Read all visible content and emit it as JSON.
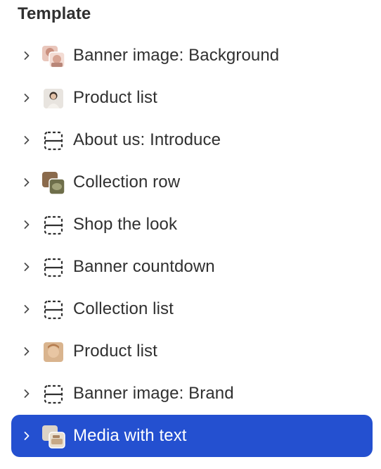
{
  "panel": {
    "title": "Template"
  },
  "sections": [
    {
      "label": "Banner image: Background",
      "icon": "image-thumbnail-icon",
      "thumb": "photo-pink"
    },
    {
      "label": "Product list",
      "icon": "image-thumbnail-icon",
      "thumb": "photo-portrait"
    },
    {
      "label": "About us: Introduce",
      "icon": "section-placeholder-icon",
      "thumb": "placeholder"
    },
    {
      "label": "Collection row",
      "icon": "image-thumbnail-icon",
      "thumb": "photo-green"
    },
    {
      "label": "Shop the look",
      "icon": "section-placeholder-icon",
      "thumb": "placeholder"
    },
    {
      "label": "Banner countdown",
      "icon": "section-placeholder-icon",
      "thumb": "placeholder"
    },
    {
      "label": "Collection list",
      "icon": "section-placeholder-icon",
      "thumb": "placeholder"
    },
    {
      "label": "Product list",
      "icon": "image-thumbnail-icon",
      "thumb": "photo-face"
    },
    {
      "label": "Banner image: Brand",
      "icon": "section-placeholder-icon",
      "thumb": "placeholder"
    },
    {
      "label": "Media with text",
      "icon": "image-thumbnail-icon",
      "thumb": "photo-beige",
      "selected": true
    }
  ],
  "colors": {
    "selected_background": "#2450d0",
    "text": "#303030",
    "selected_text": "#ffffff"
  }
}
